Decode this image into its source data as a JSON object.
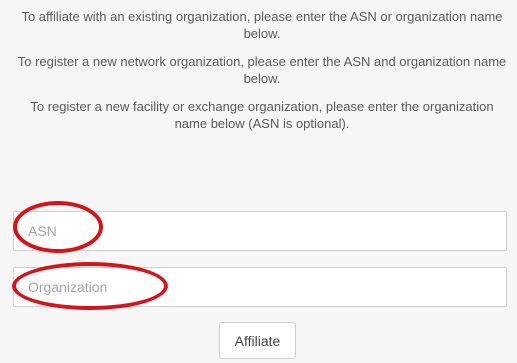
{
  "instructions": {
    "line1": "To affiliate with an existing organization, please enter the ASN or organization name below.",
    "line2": "To register a new network organization, please enter the ASN and organization name below.",
    "line3": "To register a new facility or exchange organization, please enter the organization name below (ASN is optional)."
  },
  "form": {
    "asn_placeholder": "ASN",
    "asn_value": "",
    "organization_placeholder": "Organization",
    "organization_value": "",
    "affiliate_label": "Affiliate"
  },
  "colors": {
    "annotation": "#d2151b",
    "background": "#f6f6f6",
    "text": "#5a5a5a",
    "border": "#cfcfcf"
  }
}
